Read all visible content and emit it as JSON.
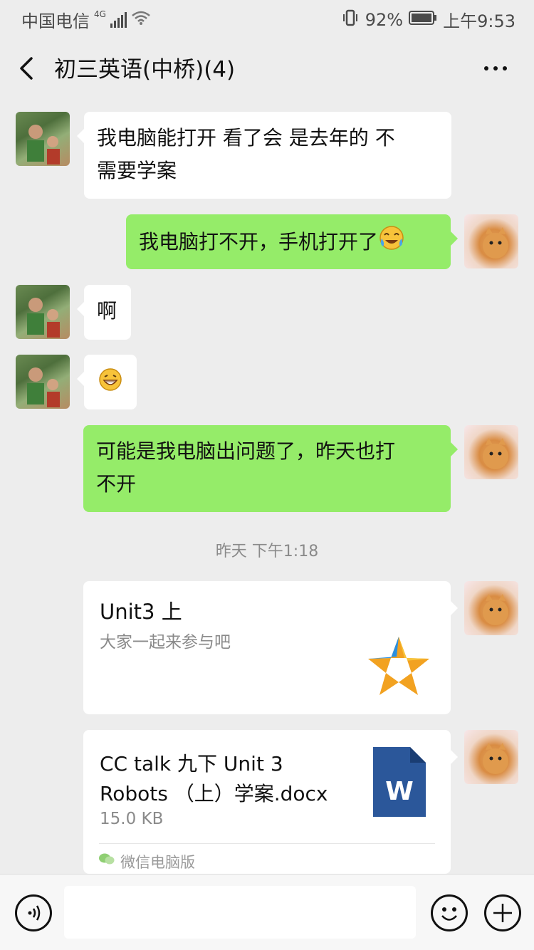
{
  "statusbar": {
    "carrier": "中国电信",
    "network": "4G",
    "battery": "92%",
    "time": "上午9:53"
  },
  "header": {
    "title": "初三英语(中桥)(4)",
    "back_icon": "chevron-left-icon",
    "more_icon": "more-icon"
  },
  "messages": [
    {
      "side": "in",
      "text_line1": "我电脑能打开 看了会 是去年的 不",
      "text_line2": "需要学案"
    },
    {
      "side": "out",
      "text": "我电脑打不开，手机打开了",
      "emoji": "crying-laughing-icon"
    },
    {
      "side": "in",
      "text": "啊"
    },
    {
      "side": "in",
      "emoji": "grin-icon"
    },
    {
      "side": "out",
      "text_line1": "可能是我电脑出问题了，昨天也打",
      "text_line2": "不开"
    }
  ],
  "timestamp": "昨天 下午1:18",
  "link_card": {
    "title": "Unit3 上",
    "desc": "大家一起来参与吧",
    "icon": "star-icon"
  },
  "file_card": {
    "name_line1": "CC talk 九下 Unit 3",
    "name_line2": "Robots （上）学案.docx",
    "size": "15.0 KB",
    "source": "微信电脑版",
    "file_icon_letter": "W"
  },
  "colors": {
    "background": "#ededed",
    "out_bubble": "#95ec69",
    "in_bubble": "#ffffff",
    "word_blue": "#2b579a"
  }
}
